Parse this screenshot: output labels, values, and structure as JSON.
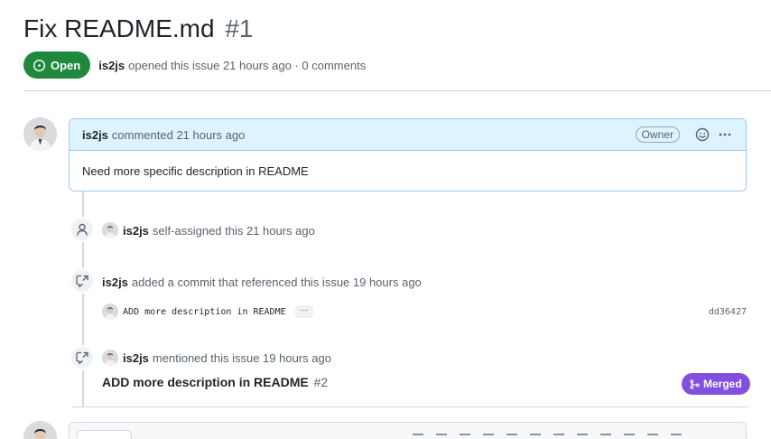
{
  "issue": {
    "title": "Fix README.md",
    "number": "#1",
    "state": "Open",
    "author": "is2js",
    "meta_text": "opened this issue 21 hours ago · 0 comments"
  },
  "comment": {
    "author": "is2js",
    "action": "commented 21 hours ago",
    "role_badge": "Owner",
    "body": "Need more specific description in README"
  },
  "events": [
    {
      "type": "assigned",
      "icon": "person-icon",
      "author": "is2js",
      "text": "self-assigned this 21 hours ago"
    },
    {
      "type": "commit-reference",
      "icon": "cross-reference-icon",
      "author": "is2js",
      "text": "added a commit that referenced this issue 19 hours ago"
    },
    {
      "type": "mention",
      "icon": "cross-reference-icon",
      "author": "is2js",
      "text": "mentioned this issue 19 hours ago"
    }
  ],
  "commit": {
    "message": "ADD more description in README",
    "ellipsis": "···",
    "sha": "dd36427"
  },
  "referenced_pr": {
    "title": "ADD more description in README",
    "number": "#2",
    "state": "Merged"
  },
  "colors": {
    "open_green": "#1f883d",
    "merged_purple": "#8250df",
    "comment_header_bg": "#ddf4ff",
    "comment_border": "#9cc9f3"
  }
}
